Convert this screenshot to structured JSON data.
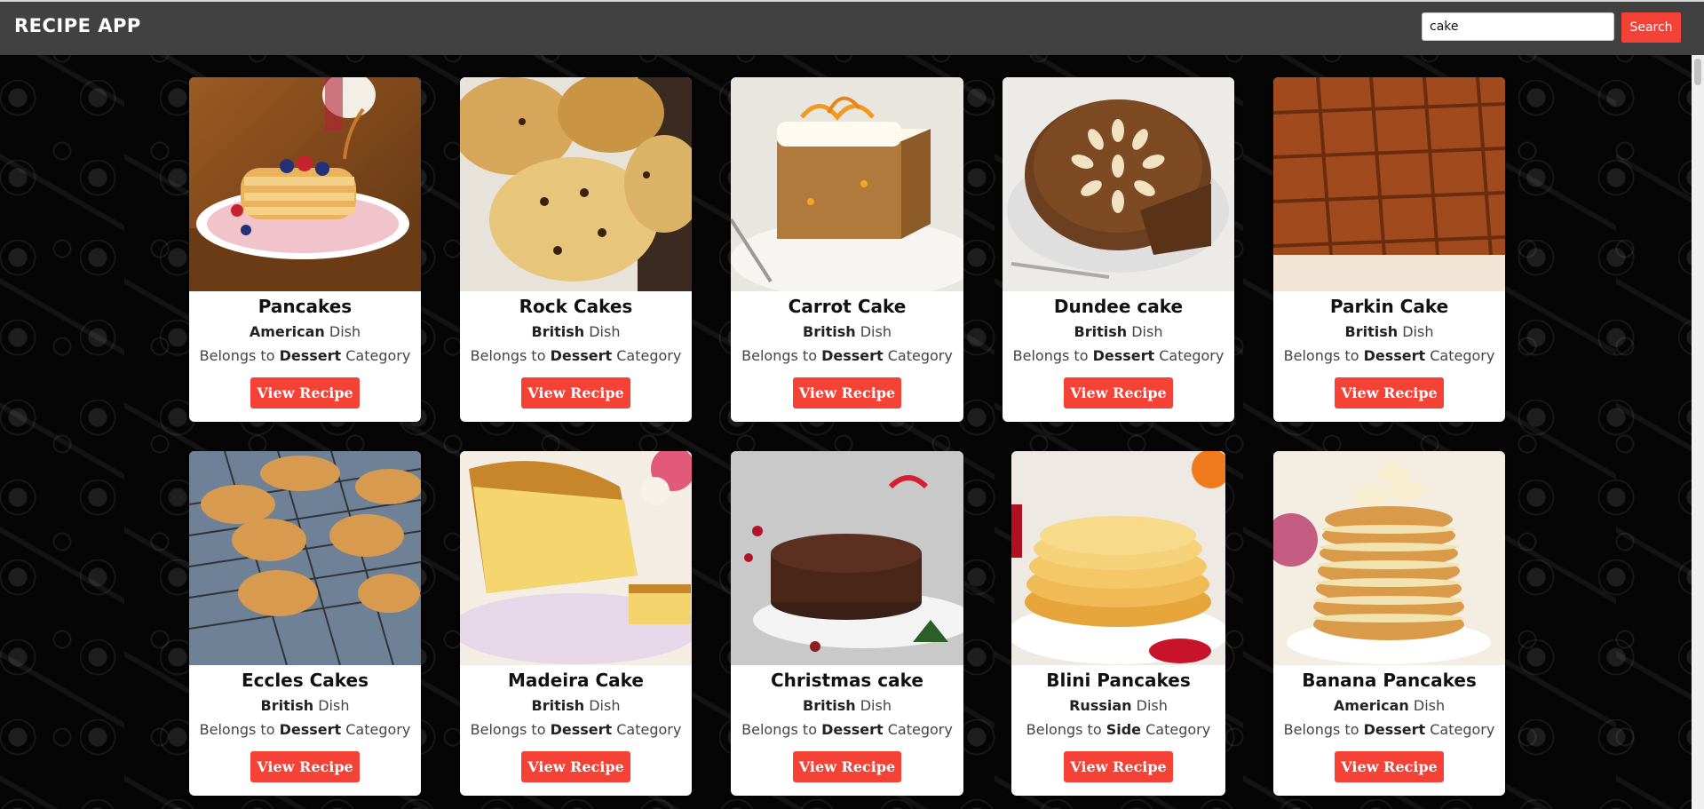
{
  "header": {
    "title": "RECIPE APP",
    "search_value": "cake",
    "search_button": "Search"
  },
  "recipes": [
    {
      "name": "Pancakes",
      "area": "American",
      "category": "Dessert",
      "button": "View Recipe",
      "image": "pancakes-photo"
    },
    {
      "name": "Rock Cakes",
      "area": "British",
      "category": "Dessert",
      "button": "View Recipe",
      "image": "rock-cakes-photo"
    },
    {
      "name": "Carrot Cake",
      "area": "British",
      "category": "Dessert",
      "button": "View Recipe",
      "image": "carrot-cake-photo"
    },
    {
      "name": "Dundee cake",
      "area": "British",
      "category": "Dessert",
      "button": "View Recipe",
      "image": "dundee-cake-photo"
    },
    {
      "name": "Parkin Cake",
      "area": "British",
      "category": "Dessert",
      "button": "View Recipe",
      "image": "parkin-cake-photo"
    },
    {
      "name": "Eccles Cakes",
      "area": "British",
      "category": "Dessert",
      "button": "View Recipe",
      "image": "eccles-cakes-photo"
    },
    {
      "name": "Madeira Cake",
      "area": "British",
      "category": "Dessert",
      "button": "View Recipe",
      "image": "madeira-cake-photo"
    },
    {
      "name": "Christmas cake",
      "area": "British",
      "category": "Dessert",
      "button": "View Recipe",
      "image": "christmas-cake-photo"
    },
    {
      "name": "Blini Pancakes",
      "area": "Russian",
      "category": "Side",
      "button": "View Recipe",
      "image": "blini-pancakes-photo"
    },
    {
      "name": "Banana Pancakes",
      "area": "American",
      "category": "Dessert",
      "button": "View Recipe",
      "image": "banana-pancakes-photo"
    }
  ],
  "labels": {
    "dish_suffix": "Dish",
    "category_prefix": "Belongs to",
    "category_suffix": "Category"
  },
  "colors": {
    "accent": "#f44336",
    "header_bg": "#414141"
  }
}
